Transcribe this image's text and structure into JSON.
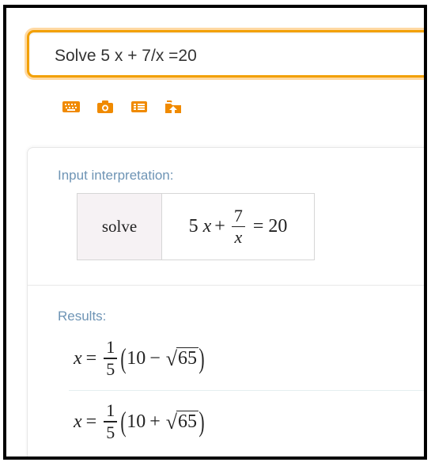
{
  "search": {
    "query": "Solve 5 x + 7/x =20"
  },
  "toolbar": {
    "icons": [
      "keyboard-icon",
      "camera-icon",
      "examples-icon",
      "upload-icon"
    ],
    "accent_color": "#f2a000"
  },
  "input_interpretation": {
    "label": "Input interpretation:",
    "command": "solve",
    "expression": {
      "coefficient": "5",
      "variable": "x",
      "plus": "+",
      "frac_numerator": "7",
      "frac_denominator": "x",
      "equals": "=",
      "rhs": "20"
    }
  },
  "results": {
    "label": "Results:",
    "label_color": "#6e94b5",
    "items": [
      {
        "variable": "x",
        "equals": "=",
        "frac_numerator": "1",
        "frac_denominator": "5",
        "open_paren": "(",
        "term": "10",
        "op": "−",
        "radicand": "65",
        "close_paren": ")"
      },
      {
        "variable": "x",
        "equals": "=",
        "frac_numerator": "1",
        "frac_denominator": "5",
        "open_paren": "(",
        "term": "10",
        "op": "+",
        "radicand": "65",
        "close_paren": ")"
      }
    ]
  }
}
